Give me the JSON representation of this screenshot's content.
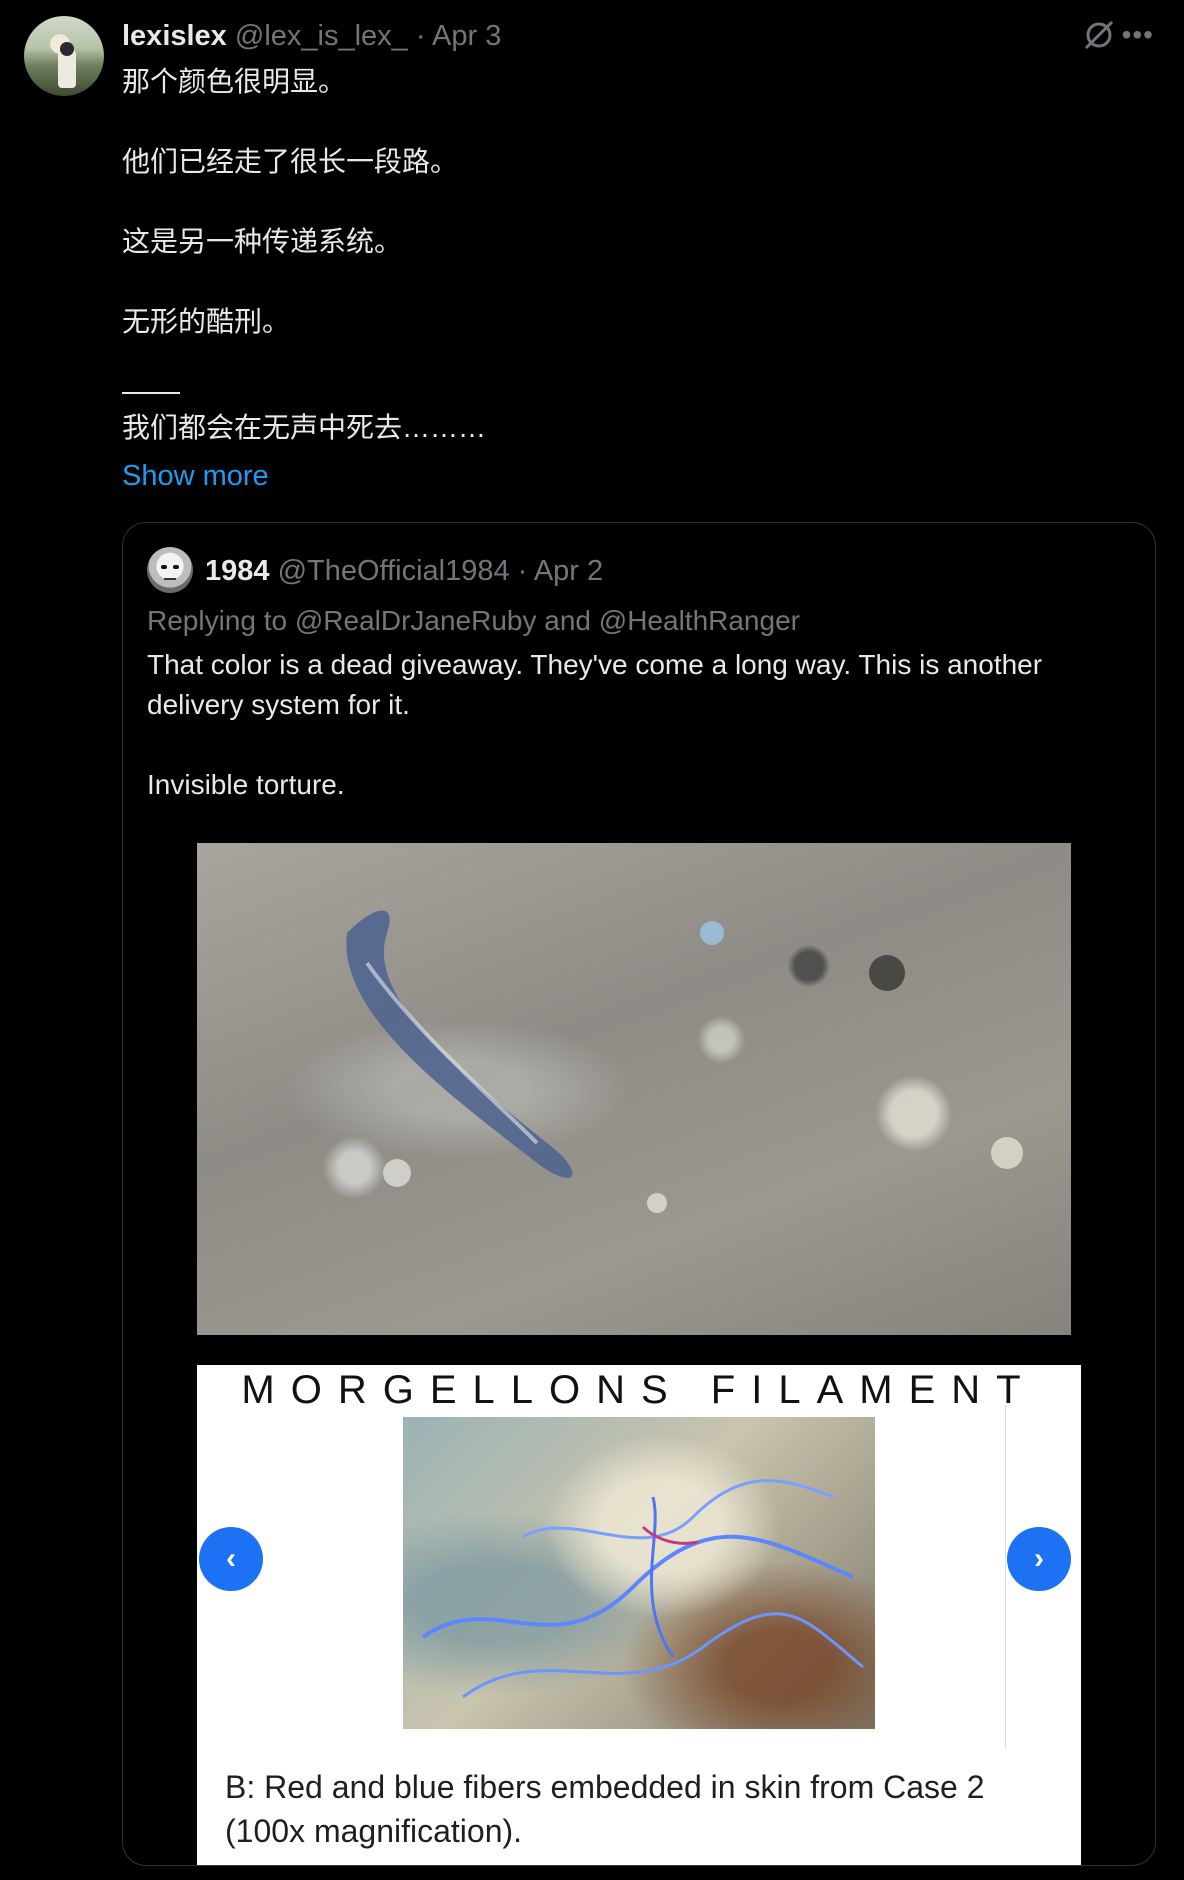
{
  "post": {
    "author_name": "lexislex",
    "author_handle": "@lex_is_lex_",
    "separator": "·",
    "date": "Apr 3",
    "lines": [
      "那个颜色很明显。",
      "他们已经走了很长一段路。",
      "这是另一种传递系统。",
      "无形的酷刑。"
    ],
    "after_rule": "我们都会在无声中死去………",
    "show_more": "Show more"
  },
  "quote": {
    "author_name": "1984",
    "author_handle": "@TheOfficial1984",
    "separator": "·",
    "date": "Apr 2",
    "replying_to": "Replying to @RealDrJaneRuby and @HealthRanger",
    "text_1": "That color is a dead giveaway. They've come a long way. This is another delivery system for it.",
    "text_2": "Invisible torture.",
    "carousel_title": "MORGELLONS FILAMENT",
    "carousel_caption": "B: Red and blue fibers embedded in skin from Case 2 (100x magnification).",
    "prev_icon": "chevron-left-icon",
    "next_icon": "chevron-right-icon"
  },
  "icons": {
    "grok": "grok-slash-icon",
    "more": "more-horizontal-icon"
  }
}
